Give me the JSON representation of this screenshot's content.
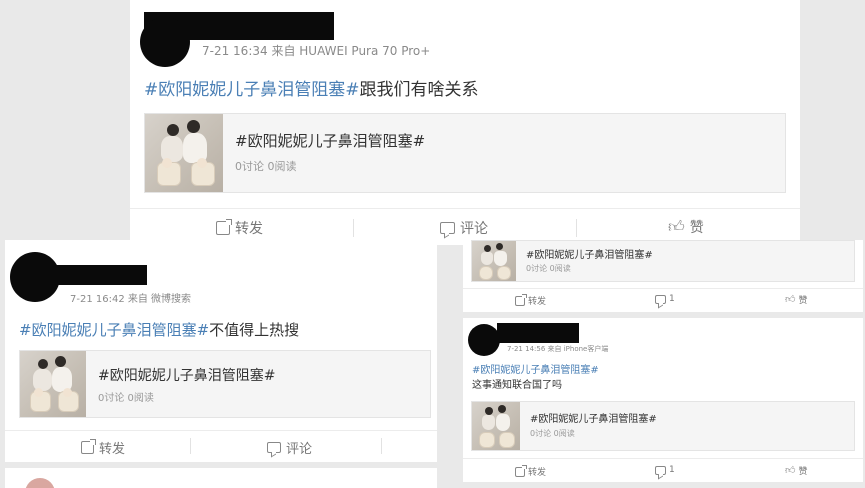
{
  "post1": {
    "meta": "7-21 16:34 来自 HUAWEI Pura 70 Pro+",
    "hashtag": "#欧阳妮妮儿子鼻泪管阻塞#",
    "text": "跟我们有啥关系",
    "topic_title": "#欧阳妮妮儿子鼻泪管阻塞#",
    "topic_sub": "0讨论 0阅读",
    "share_label": "转发",
    "comment_label": "评论",
    "like_label": "赞"
  },
  "post2": {
    "meta": "7-21 16:42 来自 微博搜索",
    "hashtag": "#欧阳妮妮儿子鼻泪管阻塞#",
    "text": "不值得上热搜",
    "topic_title": "#欧阳妮妮儿子鼻泪管阻塞#",
    "topic_sub": "0讨论 0阅读",
    "share_label": "转发",
    "comment_label": "评论"
  },
  "post3": {
    "topic_title": "#欧阳妮妮儿子鼻泪管阻塞#",
    "topic_sub": "0讨论 0阅读",
    "share_label": "转发",
    "comment_label": "1",
    "like_label": "赞"
  },
  "post4": {
    "meta": "7-21 14:56 来自 iPhone客户端",
    "hashtag": "#欧阳妮妮儿子鼻泪管阻塞#",
    "text": "这事通知联合国了吗",
    "topic_title": "#欧阳妮妮儿子鼻泪管阻塞#",
    "topic_sub": "0讨论 0阅读",
    "share_label": "转发",
    "comment_label": "1",
    "like_label": "赞"
  },
  "icons": {
    "share": "share-icon",
    "comment": "comment-icon",
    "like": "thumbs-up-icon"
  },
  "colors": {
    "hashtag": "#4a7fb5",
    "redaction": "#0a0a0a"
  }
}
